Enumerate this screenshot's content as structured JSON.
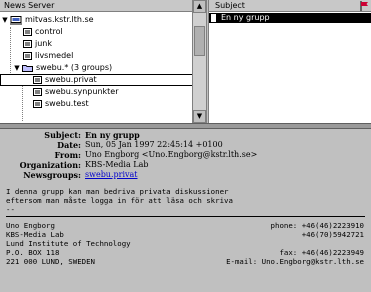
{
  "folder_pane": {
    "header": "News Server",
    "tree": [
      {
        "label": "mitvas.kstr.lth.se",
        "expanded": true
      },
      {
        "label": "control"
      },
      {
        "label": "junk"
      },
      {
        "label": "livsmedel"
      },
      {
        "label": "swebu.* (3 groups)",
        "expanded": true
      },
      {
        "label": "swebu.privat",
        "selected": true
      },
      {
        "label": "swebu.synpunkter"
      },
      {
        "label": "swebu.test"
      }
    ]
  },
  "message_list": {
    "header": "Subject",
    "rows": [
      {
        "subject": "En ny grupp",
        "selected": true
      }
    ]
  },
  "message": {
    "headers": [
      {
        "key": "Subject:",
        "value": "En ny grupp",
        "style": "bold"
      },
      {
        "key": "Date:",
        "value": "Sun, 05 Jan 1997 22:45:14 +0100"
      },
      {
        "key": "From:",
        "value": "Uno Engborg <Uno.Engborg@kstr.lth.se>"
      },
      {
        "key": "Organization:",
        "value": "KBS-Media Lab"
      },
      {
        "key": "Newsgroups:",
        "value": "swebu.privat",
        "style": "link"
      }
    ],
    "body_lines": [
      "I denna grupp kan man bedriva privata diskussioner",
      "eftersom man måste logga in för att läsa och skriva",
      "--"
    ],
    "signature": {
      "left": [
        "Uno Engborg",
        "KBS-Media Lab",
        "Lund Institute of Technology",
        "P.O. BOX 118",
        "221 000 LUND, SWEDEN"
      ],
      "right": [
        "phone: +46(46)2223910",
        "+46(70)5942721",
        "",
        "fax: +46(46)2223949",
        "E-mail: Uno.Engborg@kstr.lth.se"
      ]
    }
  },
  "colors": {
    "chrome": "#c0c0c0",
    "selected_row_bg": "#000000",
    "link": "#0000cc",
    "flag": "#cc0033"
  }
}
